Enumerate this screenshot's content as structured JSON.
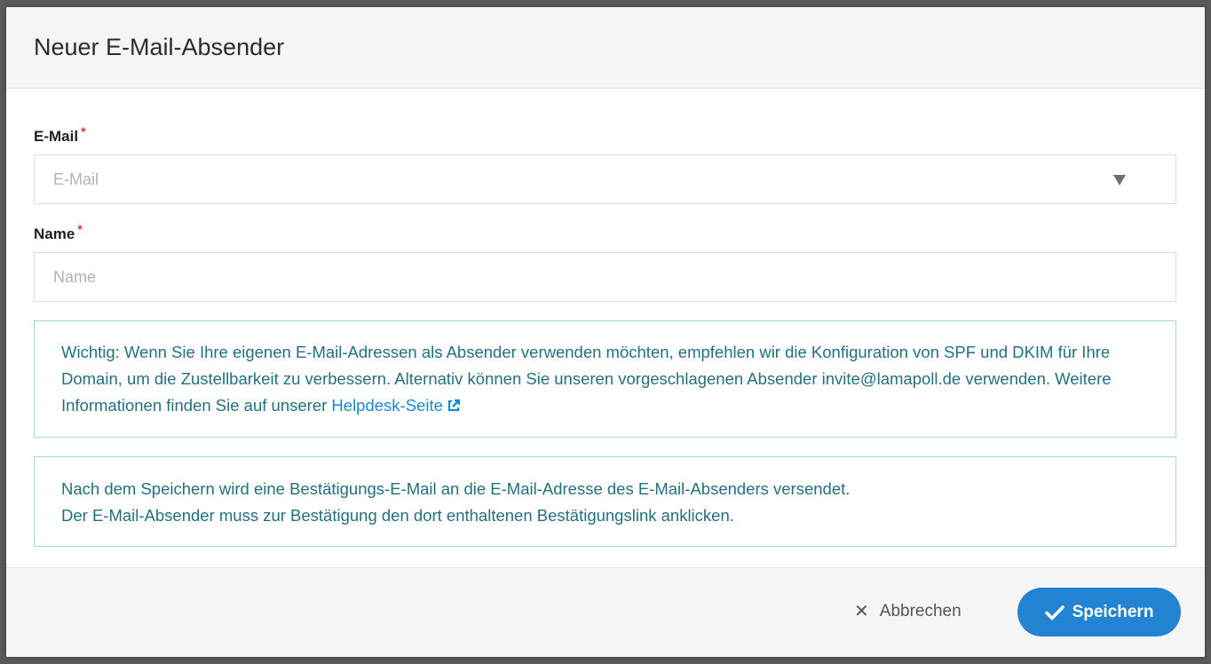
{
  "dialog": {
    "title": "Neuer E-Mail-Absender"
  },
  "form": {
    "email": {
      "label": "E-Mail",
      "required_mark": "*",
      "placeholder": "E-Mail",
      "value": ""
    },
    "name": {
      "label": "Name",
      "required_mark": "*",
      "placeholder": "Name",
      "value": ""
    }
  },
  "info": {
    "important_text": "Wichtig: Wenn Sie Ihre eigenen E-Mail-Adressen als Absender verwenden möchten, empfehlen wir die Konfiguration von SPF und DKIM für Ihre Domain, um die Zustellbarkeit zu verbessern. Alternativ können Sie unseren vorgeschlagenen Absender invite@lamapoll.de verwenden. Weitere Informationen finden Sie auf unserer ",
    "helpdesk_link": "Helpdesk-Seite",
    "confirmation_line1": "Nach dem Speichern wird eine Bestätigungs-E-Mail an die E-Mail-Adresse des E-Mail-Absenders versendet.",
    "confirmation_line2": "Der E-Mail-Absender muss zur Bestätigung den dort enthaltenen Bestätigungslink anklicken."
  },
  "footer": {
    "cancel_label": "Abbrechen",
    "save_label": "Speichern"
  },
  "icons": {
    "cancel": "close-icon",
    "save": "check-icon",
    "link": "external-link-icon",
    "select": "caret-down-icon"
  },
  "colors": {
    "primary": "#2283d3",
    "info_text": "#23707f",
    "info_border": "#a9d6df",
    "required": "#d9382f",
    "link": "#1f86cf"
  }
}
